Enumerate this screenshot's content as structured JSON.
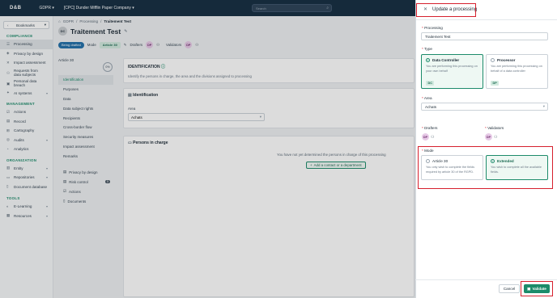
{
  "topbar": {
    "logo": "D&B",
    "app": "GDPR",
    "org": "[CPC] Dunder Mifflin Paper Company",
    "search_placeholder": "Search"
  },
  "sidebar": {
    "bookmarks": "Bookmarks",
    "sections": [
      {
        "title": "COMPLIANCE",
        "items": [
          "Processing",
          "Privacy by design",
          "Impact assessment",
          "Requests from data subjects",
          "Personal data breach",
          "AI systems"
        ]
      },
      {
        "title": "MANAGEMENT",
        "items": [
          "Actions",
          "Record",
          "Cartography",
          "Audits",
          "Analytics"
        ]
      },
      {
        "title": "ORGANIZATION",
        "items": [
          "Entity",
          "Repositories",
          "Document database"
        ]
      },
      {
        "title": "TOOLS",
        "items": [
          "E-Learning",
          "Resources"
        ]
      }
    ]
  },
  "breadcrumb": {
    "root": "GDPR",
    "parent": "Processing",
    "current": "Traitement Test"
  },
  "header": {
    "avatar": "DC",
    "title": "Traitement Test"
  },
  "chips": {
    "status": "Being drafted",
    "mode_label": "Mode",
    "mode_value": "Article 30",
    "drafters": "Drafters",
    "drafter_initials": "DP",
    "validators": "Validators",
    "validator_initials": "DP"
  },
  "left_panel": {
    "title": "Article 30",
    "progress": "0%",
    "nav": [
      "Identification",
      "Purposes",
      "Data",
      "Data subject rights",
      "Recipients",
      "Cross-border flow",
      "Security measures",
      "Impact assessment",
      "Remarks"
    ],
    "nav2": [
      {
        "label": "Privacy by design"
      },
      {
        "label": "Risk control",
        "badge": "0"
      },
      {
        "label": "Actions"
      },
      {
        "label": "Documents"
      }
    ]
  },
  "main": {
    "section_title": "IDENTIFICATION",
    "section_desc": "Identify the persons in charge, the area and the divisions assigned to processing",
    "ident_title": "Identification",
    "area_label": "Area",
    "area_value": "Achats",
    "persons_title": "Persons in charge",
    "persons_empty": "You have not yet determined the persons in charge of this processing",
    "add_contact": "Add a contact or a department"
  },
  "panel": {
    "title": "Update a processing",
    "processing_label": "Processing",
    "processing_value": "Traitement Test",
    "type_label": "Type",
    "types": [
      {
        "title": "Data Controller",
        "desc": "You are performing this processing on your own behalf",
        "badge": "DC",
        "selected": true
      },
      {
        "title": "Processor",
        "desc": "You are performing this processing on behalf of a data controller",
        "badge": "DP",
        "selected": false
      }
    ],
    "area_label": "Area",
    "area_value": "Achats",
    "drafters_label": "Drafters",
    "drafters_initials": "DP",
    "validators_label": "Validators",
    "validators_initials": "DP",
    "mode_label": "Mode",
    "modes": [
      {
        "title": "Article 30",
        "desc": "You only wish to complete the fields required by article 30 of the RGPD.",
        "selected": false
      },
      {
        "title": "Extended",
        "desc": "You wish to complete all the available fields.",
        "selected": true
      }
    ],
    "cancel": "Cancel",
    "validate": "Validate"
  },
  "colors": {
    "brand": "#1c8b6a",
    "topbar": "#122b40",
    "highlight": "#d6202e"
  }
}
